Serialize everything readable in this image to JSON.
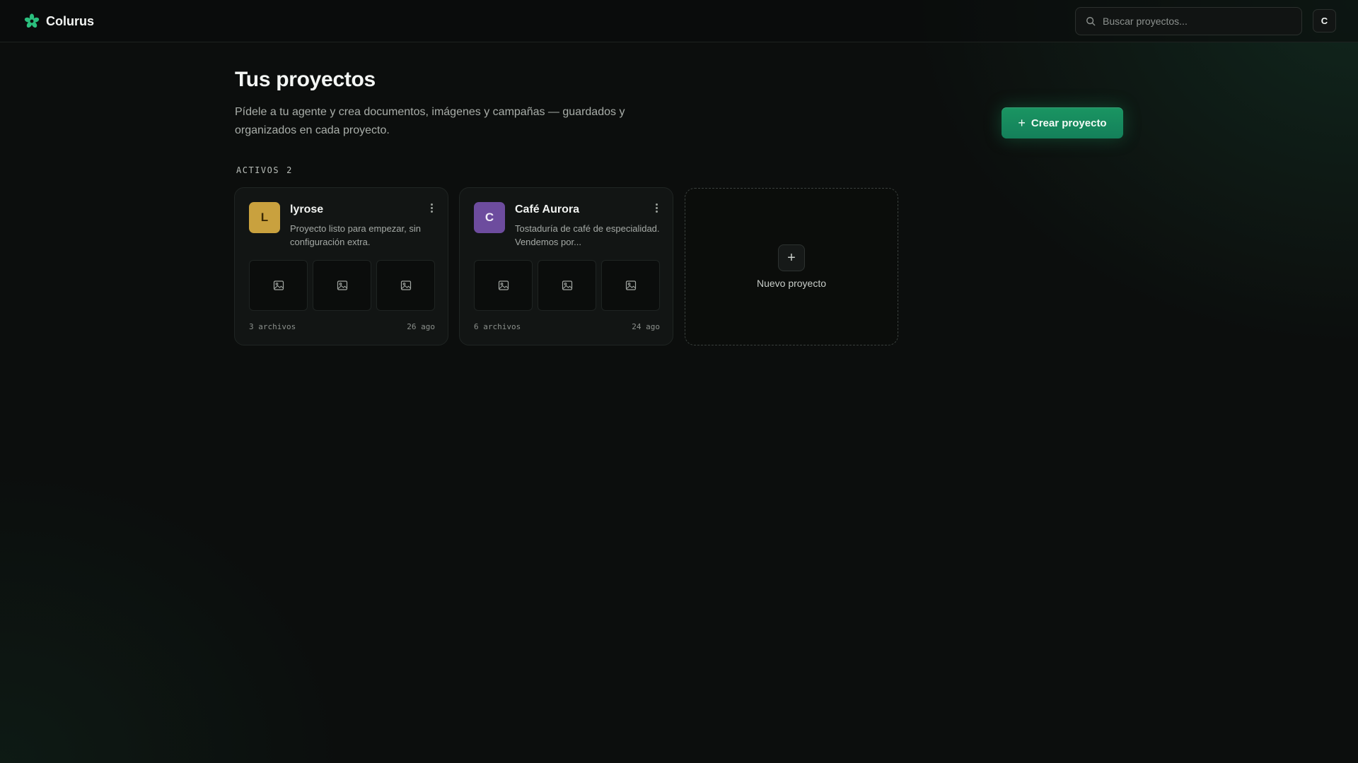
{
  "app": {
    "name": "Colurus",
    "brand_color": "#2bbf7e"
  },
  "search": {
    "placeholder": "Buscar proyectos..."
  },
  "user": {
    "initial": "C"
  },
  "header": {
    "title": "Tus proyectos",
    "subtitle": "Pídele a tu agente y crea documentos, imágenes y campañas — guardados y organizados en cada proyecto.",
    "create_label": "Crear proyecto"
  },
  "section": {
    "label": "ACTIVOS",
    "count": "2"
  },
  "projects": [
    {
      "initial": "L",
      "name": "lyrose",
      "description": "Proyecto listo para empezar, sin configuración extra.",
      "files": "3 archivos",
      "date": "26 ago",
      "avatar_color": "#c9a13e",
      "avatar_text_color": "#3b2a05"
    },
    {
      "initial": "C",
      "name": "Café Aurora",
      "description": "Tostaduría de café de especialidad. Vendemos por...",
      "files": "6 archivos",
      "date": "24 ago",
      "avatar_color": "#6d4c9e",
      "avatar_text_color": "#f1ecf8"
    }
  ],
  "new_project": {
    "label": "Nuevo proyecto"
  },
  "icons": {
    "logo": "flower-logo-icon",
    "search": "search-icon",
    "menu": "more-vertical-icon",
    "thumb": "image-placeholder-icon",
    "add": "plus-icon"
  }
}
